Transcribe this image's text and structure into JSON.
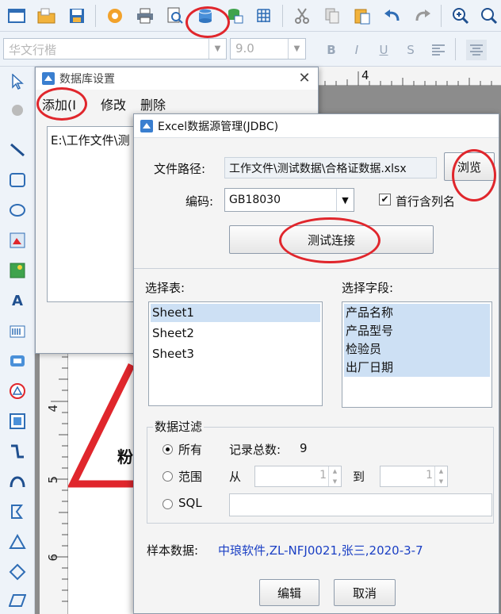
{
  "toolbar": {
    "icons": [
      "window-icon",
      "open-folder-icon",
      "save-icon",
      "settings-icon",
      "print-icon",
      "print-preview-icon",
      "database-icon",
      "database-link-icon",
      "grid-icon",
      "cut-icon",
      "copy-icon",
      "paste-icon",
      "undo-icon",
      "redo-icon",
      "zoom-in-icon",
      "zoom-icon"
    ]
  },
  "format_bar": {
    "font_name": "华文行楷",
    "font_size": "9.0",
    "bold": "B",
    "italic": "I",
    "underline": "U",
    "strike": "S"
  },
  "canvas": {
    "ruler_top_mark": "4",
    "ruler_left_marks": [
      "4",
      "5",
      "6"
    ],
    "label_text": "粉"
  },
  "db_settings_dialog": {
    "title": "数据库设置",
    "menu": [
      "添加(I",
      "修改",
      "删除"
    ],
    "list_items": [
      "E:\\工作文件\\测"
    ]
  },
  "excel_dialog": {
    "title": "Excel数据源管理(JDBC)",
    "file_path_label": "文件路径:",
    "file_path_value": "工作文件\\测试数据\\合格证数据.xlsx",
    "browse_button": "浏览",
    "encoding_label": "编码:",
    "encoding_value": "GB18030",
    "first_row_header_label": "首行含列名",
    "first_row_header_checked": true,
    "test_connection_button": "测试连接",
    "select_table_label": "选择表:",
    "tables": [
      {
        "name": "Sheet1",
        "selected": true
      },
      {
        "name": "Sheet2",
        "selected": false
      },
      {
        "name": "Sheet3",
        "selected": false
      }
    ],
    "select_fields_label": "选择字段:",
    "fields": [
      {
        "name": "产品名称",
        "selected": true
      },
      {
        "name": "产品型号",
        "selected": true
      },
      {
        "name": "检验员",
        "selected": true
      },
      {
        "name": "出厂日期",
        "selected": true
      }
    ],
    "filter_group_label": "数据过滤",
    "filter_all_label": "所有",
    "record_count_label": "记录总数:",
    "record_count_value": "9",
    "filter_range_label": "范围",
    "from_label": "从",
    "range_from_value": "1",
    "to_label": "到",
    "range_to_value": "1",
    "filter_sql_label": "SQL",
    "sql_value": "",
    "selected_filter": "all",
    "sample_label": "样本数据:",
    "sample_value": "中琅软件,ZL-NFJ0021,张三,2020-3-7",
    "edit_button": "编辑",
    "cancel_button": "取消"
  },
  "colors": {
    "annotation": "#e0262c",
    "sample_text": "#1a3fc4",
    "selection": "#cde0f4"
  }
}
